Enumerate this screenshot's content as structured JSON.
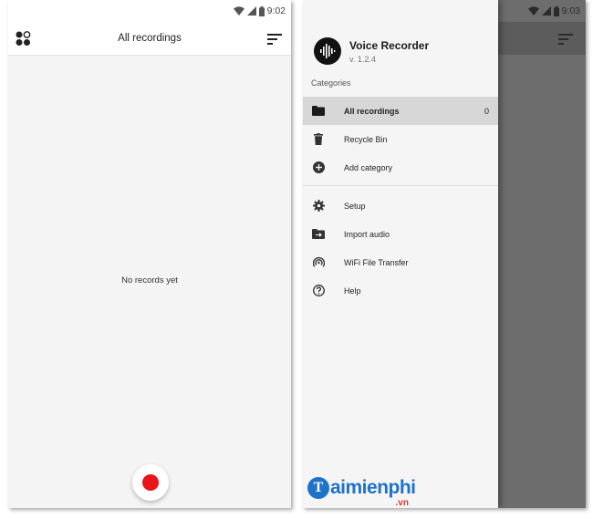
{
  "left": {
    "status": {
      "time": "9:02"
    },
    "appbar": {
      "title": "All recordings"
    },
    "empty_message": "No records yet",
    "record_button_color": "#e8151b"
  },
  "right": {
    "status": {
      "time": "9:03"
    },
    "drawer": {
      "app_name": "Voice Recorder",
      "version": "v. 1.2.4",
      "section_label": "Categories",
      "items": [
        {
          "label": "All recordings",
          "icon": "folder-icon",
          "count": "0",
          "active": true
        },
        {
          "label": "Recycle Bin",
          "icon": "trash-icon"
        },
        {
          "label": "Add category",
          "icon": "add-circle-icon"
        }
      ],
      "items2": [
        {
          "label": "Setup",
          "icon": "gear-icon"
        },
        {
          "label": "Import audio",
          "icon": "import-folder-icon"
        },
        {
          "label": "WiFi File Transfer",
          "icon": "wifi-transfer-icon"
        },
        {
          "label": "Help",
          "icon": "help-icon"
        }
      ]
    }
  },
  "watermark": {
    "brand": "aimienphi",
    "badge": "T",
    "suffix": ".vn"
  }
}
